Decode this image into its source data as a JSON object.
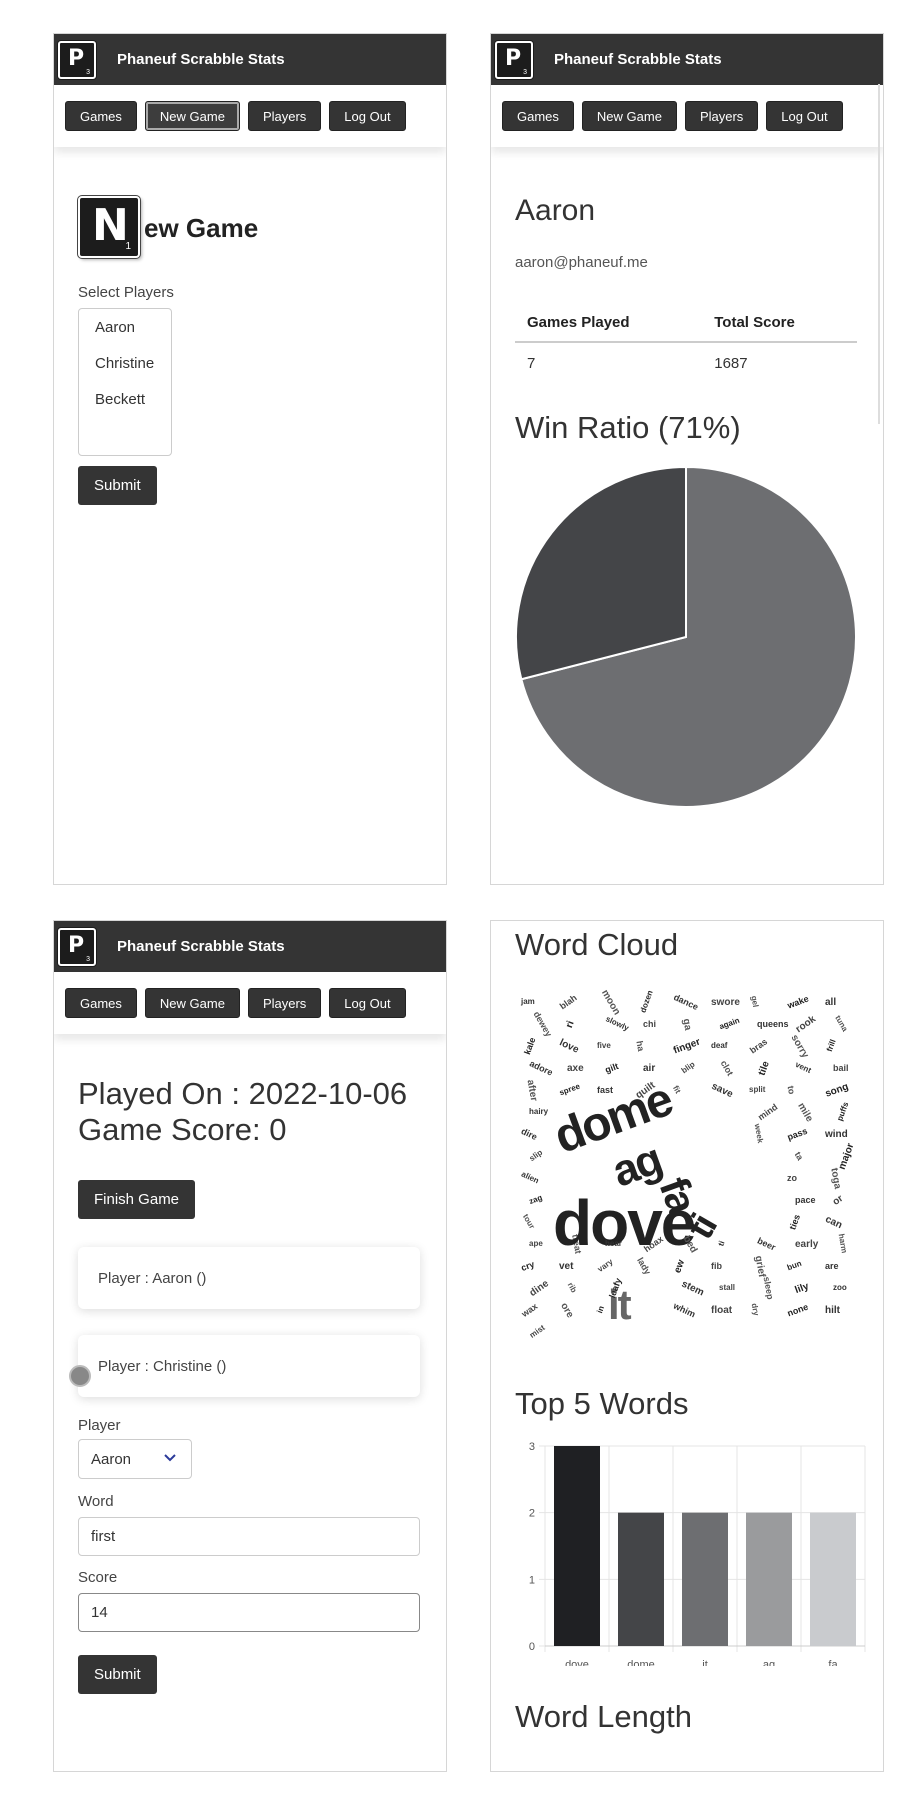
{
  "nav": {
    "brand": "Phaneuf Scrabble Stats",
    "logo_letter": "P",
    "logo_score": "3",
    "buttons": [
      "Games",
      "New Game",
      "Players",
      "Log Out"
    ]
  },
  "new_game": {
    "tile_letter": "N",
    "tile_score": "1",
    "title_rest": "ew Game",
    "select_label": "Select Players",
    "players": [
      "Aaron",
      "Christine",
      "Beckett"
    ],
    "submit": "Submit"
  },
  "player": {
    "name": "Aaron",
    "email": "aaron@phaneuf.me",
    "table_headers": [
      "Games Played",
      "Total Score"
    ],
    "table_row": [
      "7",
      "1687"
    ],
    "win_ratio_title": "Win Ratio (71%)",
    "win_ratio": 0.71,
    "pie_colors": [
      "#6d6e71",
      "#444548"
    ]
  },
  "game": {
    "played_on": "Played On : 2022-10-06",
    "game_score": "Game Score: 0",
    "finish_button": "Finish Game",
    "player_cards": [
      "Player : Aaron ()",
      "Player : Christine ()"
    ],
    "player_label": "Player",
    "player_value": "Aaron",
    "word_label": "Word",
    "word_value": "first",
    "score_label": "Score",
    "score_value": "14",
    "submit": "Submit"
  },
  "stats": {
    "word_cloud_title": "Word Cloud",
    "word_cloud_words": [
      "jam",
      "blah",
      "moon",
      "dozen",
      "dance",
      "swore",
      "gel",
      "wake",
      "all",
      "ti",
      "dewey",
      "ri",
      "slowly",
      "chi",
      "ga",
      "again",
      "queens",
      "rook",
      "tuna",
      "kale",
      "love",
      "five",
      "ha",
      "finger",
      "deaf",
      "bras",
      "sorry",
      "frill",
      "adore",
      "axe",
      "dome",
      "gilt",
      "air",
      "blip",
      "clot",
      "tile",
      "vent",
      "bail",
      "after",
      "spree",
      "fast",
      "quilt",
      "fit",
      "ag",
      "save",
      "split",
      "to",
      "song",
      "hairy",
      "mind",
      "mile",
      "puffs",
      "dire",
      "fa",
      "week",
      "pass",
      "wind",
      "slip",
      "ta",
      "major",
      "alien",
      "zo",
      "toga",
      "zag",
      "pace",
      "or",
      "tour",
      "ties",
      "can",
      "ape",
      "treat",
      "dove",
      "hear",
      "hoax",
      "bed",
      "ti",
      "beer",
      "early",
      "harm",
      "cry",
      "vet",
      "vary",
      "lady",
      "ew",
      "it",
      "fib",
      "grief",
      "bun",
      "are",
      "dine",
      "rib",
      "leafy",
      "stem",
      "stall",
      "sleep",
      "lily",
      "zoo",
      "wax",
      "ore",
      "in",
      "whim",
      "float",
      "dry",
      "none",
      "hilt",
      "mist"
    ],
    "top_words_title": "Top 5 Words",
    "word_length_title": "Word Length",
    "chart_data": {
      "type": "bar",
      "categories": [
        "dove",
        "dome",
        "it",
        "ag",
        "fa"
      ],
      "values": [
        3,
        2,
        2,
        2,
        2
      ],
      "colors": [
        "#1f2023",
        "#444548",
        "#6d6e71",
        "#9a9b9d",
        "#c9cbce"
      ],
      "ylim": [
        0,
        3
      ],
      "yticks": [
        "0",
        "1",
        "2",
        "3"
      ],
      "grid": true
    }
  }
}
